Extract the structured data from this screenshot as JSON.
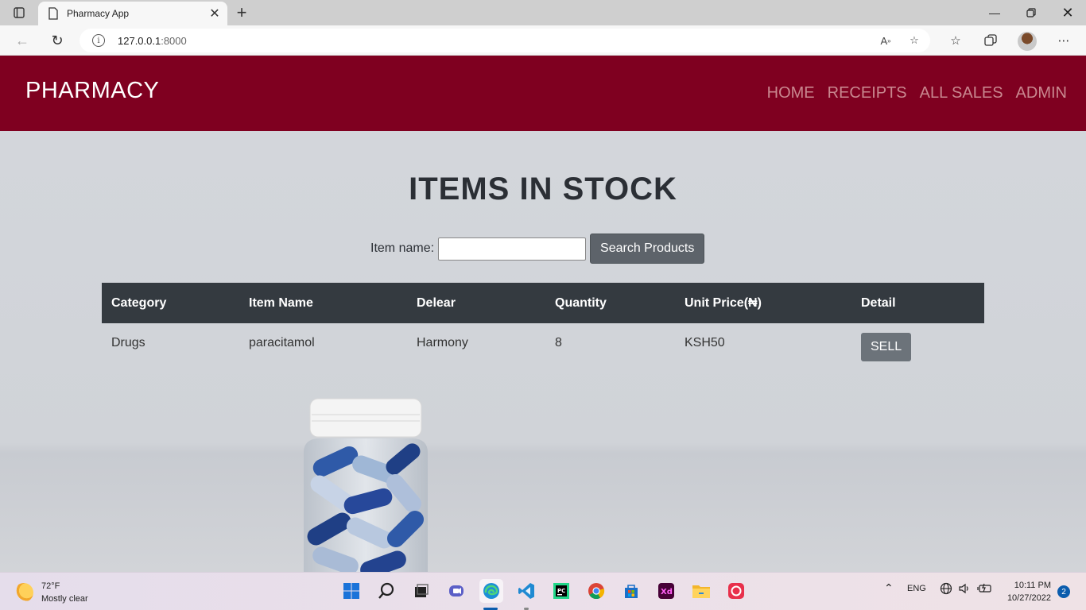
{
  "browser": {
    "tab_title": "Pharmacy App",
    "url_host": "127.0.0.1",
    "url_port": ":8000"
  },
  "site": {
    "brand": "PHARMACY",
    "nav": [
      "HOME",
      "RECEIPTS",
      "ALL SALES",
      "ADMIN"
    ]
  },
  "main": {
    "heading": "ITEMS IN STOCK",
    "search_label": "Item name:",
    "search_value": "",
    "search_button": "Search Products",
    "table": {
      "headers": [
        "Category",
        "Item Name",
        "Delear",
        "Quantity",
        "Unit Price(₦)",
        "Detail"
      ],
      "rows": [
        {
          "category": "Drugs",
          "item_name": "paracitamol",
          "dealer": "Harmony",
          "quantity": "8",
          "unit_price": "KSH50",
          "action": "SELL"
        }
      ]
    }
  },
  "taskbar": {
    "temperature": "72°F",
    "weather": "Mostly clear",
    "language": "ENG",
    "time": "10:11 PM",
    "date": "10/27/2022",
    "notifications": "2"
  }
}
